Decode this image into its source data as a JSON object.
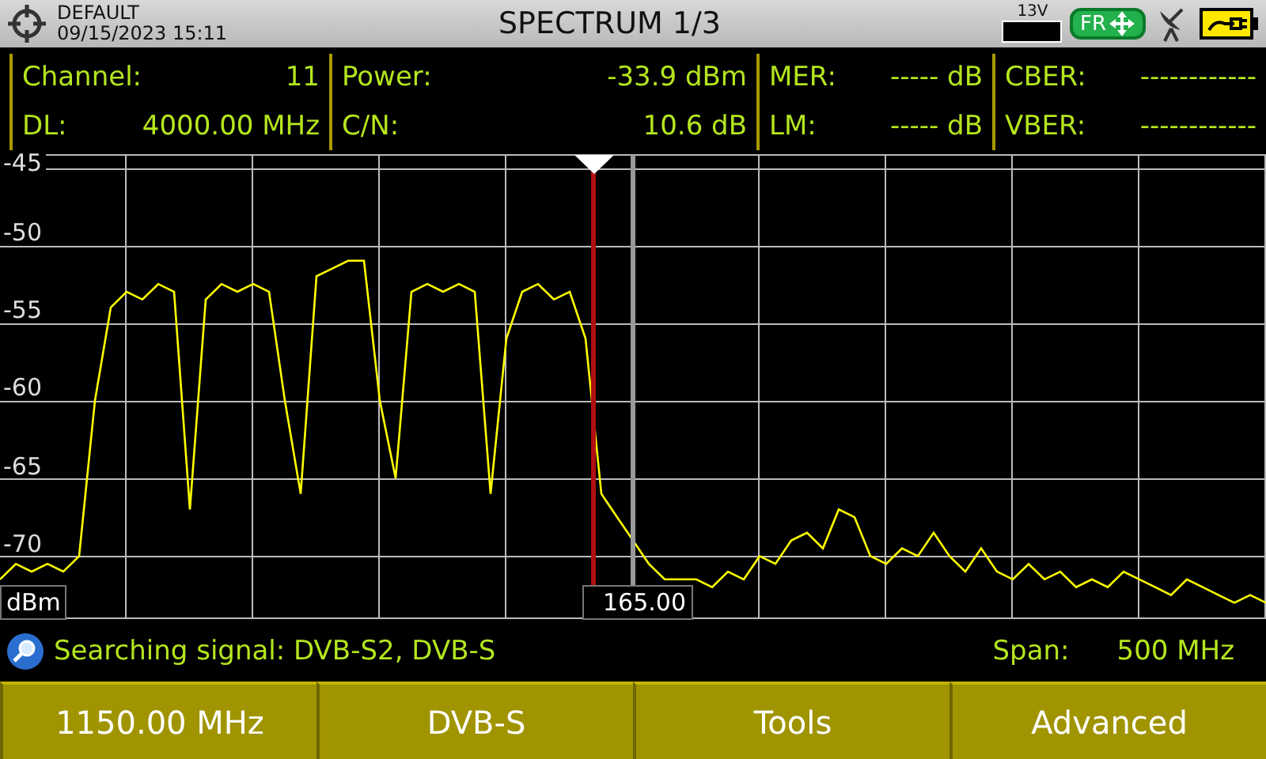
{
  "header": {
    "profile": "DEFAULT",
    "datetime": "09/15/2023 15:11",
    "title": "SPECTRUM 1/3",
    "voltage": "13V",
    "badge": "FR"
  },
  "measurements": [
    [
      {
        "label": "Channel:",
        "value": "11"
      },
      {
        "label": "DL:",
        "value": "4000.00 MHz"
      }
    ],
    [
      {
        "label": "Power:",
        "value": "-33.9 dBm"
      },
      {
        "label": "C/N:",
        "value": "10.6 dB"
      }
    ],
    [
      {
        "label": "MER:",
        "value": "----- dB"
      },
      {
        "label": "LM:",
        "value": "----- dB"
      }
    ],
    [
      {
        "label": "CBER:",
        "value": "------------"
      },
      {
        "label": "VBER:",
        "value": "------------"
      }
    ]
  ],
  "spectrum": {
    "chart_data": {
      "type": "line",
      "ylabel": "dBm",
      "ylim": [
        -74,
        -44.2
      ],
      "grid": true,
      "yticks": [
        -45,
        -50,
        -55,
        -60,
        -65,
        -70
      ],
      "series": [
        {
          "color": "#ffff00",
          "values": [
            -71.5,
            -70.5,
            -71,
            -70.5,
            -71,
            -70,
            -60,
            -54,
            -53,
            -53.5,
            -52.5,
            -53,
            -67,
            -53.5,
            -52.5,
            -53,
            -52.5,
            -53,
            -60,
            -66,
            -52,
            -51.5,
            -51,
            -51,
            -60,
            -65,
            -53,
            -52.5,
            -53,
            -52.5,
            -53,
            -66,
            -56,
            -53,
            -52.5,
            -53.5,
            -53,
            -56,
            -66,
            -67.5,
            -69,
            -70.5,
            -71.5,
            -71.5,
            -71.5,
            -72,
            -71,
            -71.5,
            -70,
            -70.5,
            -69,
            -68.5,
            -69.5,
            -67,
            -67.5,
            -70,
            -70.5,
            -69.5,
            -70,
            -68.5,
            -70,
            -71,
            -69.5,
            -71,
            -71.5,
            -70.5,
            -71.5,
            -71,
            -72,
            -71.5,
            -72,
            -71,
            -71.5,
            -72,
            -72.5,
            -71.5,
            -72,
            -72.5,
            -73,
            -72.5,
            -73
          ]
        }
      ]
    },
    "marker_readout": "165.00"
  },
  "status": {
    "message": "Searching signal: DVB-S2, DVB-S",
    "span_label": "Span:",
    "span_value": "500 MHz"
  },
  "softkeys": [
    "1150.00 MHz",
    "DVB-S",
    "Tools",
    "Advanced"
  ]
}
